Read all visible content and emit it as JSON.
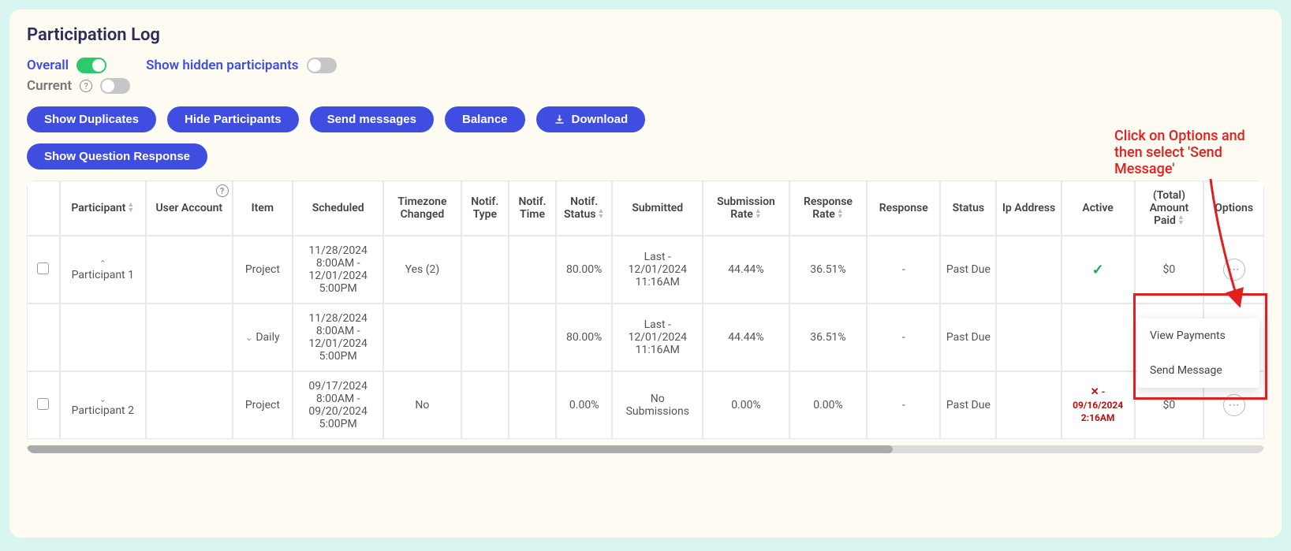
{
  "title": "Participation Log",
  "toggles": {
    "overall": {
      "label": "Overall",
      "on": true
    },
    "current": {
      "label": "Current",
      "on": false
    },
    "hidden": {
      "label": "Show hidden participants",
      "on": false
    }
  },
  "buttons": {
    "show_duplicates": "Show Duplicates",
    "hide_participants": "Hide Participants",
    "send_messages": "Send messages",
    "balance": "Balance",
    "download": "Download",
    "show_question_response": "Show Question Response"
  },
  "annotation": "Click on Options and then select 'Send Message'",
  "columns": {
    "participant": "Participant",
    "user_account": "User Account",
    "item": "Item",
    "scheduled": "Scheduled",
    "timezone_changed": "Timezone Changed",
    "notif_type": "Notif. Type",
    "notif_time": "Notif. Time",
    "notif_status": "Notif. Status",
    "submitted": "Submitted",
    "submission_rate": "Submission Rate",
    "response_rate": "Response Rate",
    "response": "Response",
    "status": "Status",
    "ip_address": "Ip Address",
    "active": "Active",
    "total_amount_paid": "(Total) Amount Paid",
    "options": "Options"
  },
  "rows": [
    {
      "participant": "Participant 1",
      "item": "Project",
      "scheduled": "11/28/2024 8:00AM - 12/01/2024 5:00PM",
      "timezone_changed": "Yes (2)",
      "notif_status": "80.00%",
      "submitted": "Last - 12/01/2024 11:16AM",
      "submission_rate": "44.44%",
      "response_rate": "36.51%",
      "response": "-",
      "status": "Past Due",
      "active_kind": "check",
      "amount_paid": "$0",
      "collapse": "up"
    },
    {
      "participant": "",
      "item": "Daily",
      "scheduled": "11/28/2024 8:00AM - 12/01/2024 5:00PM",
      "timezone_changed": "",
      "notif_status": "80.00%",
      "submitted": "Last - 12/01/2024 11:16AM",
      "submission_rate": "44.44%",
      "response_rate": "36.51%",
      "response": "-",
      "status": "Past Due",
      "active_kind": "",
      "amount_paid": "",
      "item_chev": true
    },
    {
      "participant": "Participant 2",
      "item": "Project",
      "scheduled": "09/17/2024 8:00AM - 09/20/2024 5:00PM",
      "timezone_changed": "No",
      "notif_status": "0.00%",
      "submitted": "No Submissions",
      "submission_rate": "0.00%",
      "response_rate": "0.00%",
      "response": "-",
      "status": "Past Due",
      "active_kind": "x",
      "active_date": "09/16/2024 2:16AM",
      "amount_paid": "$0",
      "collapse": "down"
    }
  ],
  "popup": {
    "view_payments": "View Payments",
    "send_message": "Send Message"
  }
}
